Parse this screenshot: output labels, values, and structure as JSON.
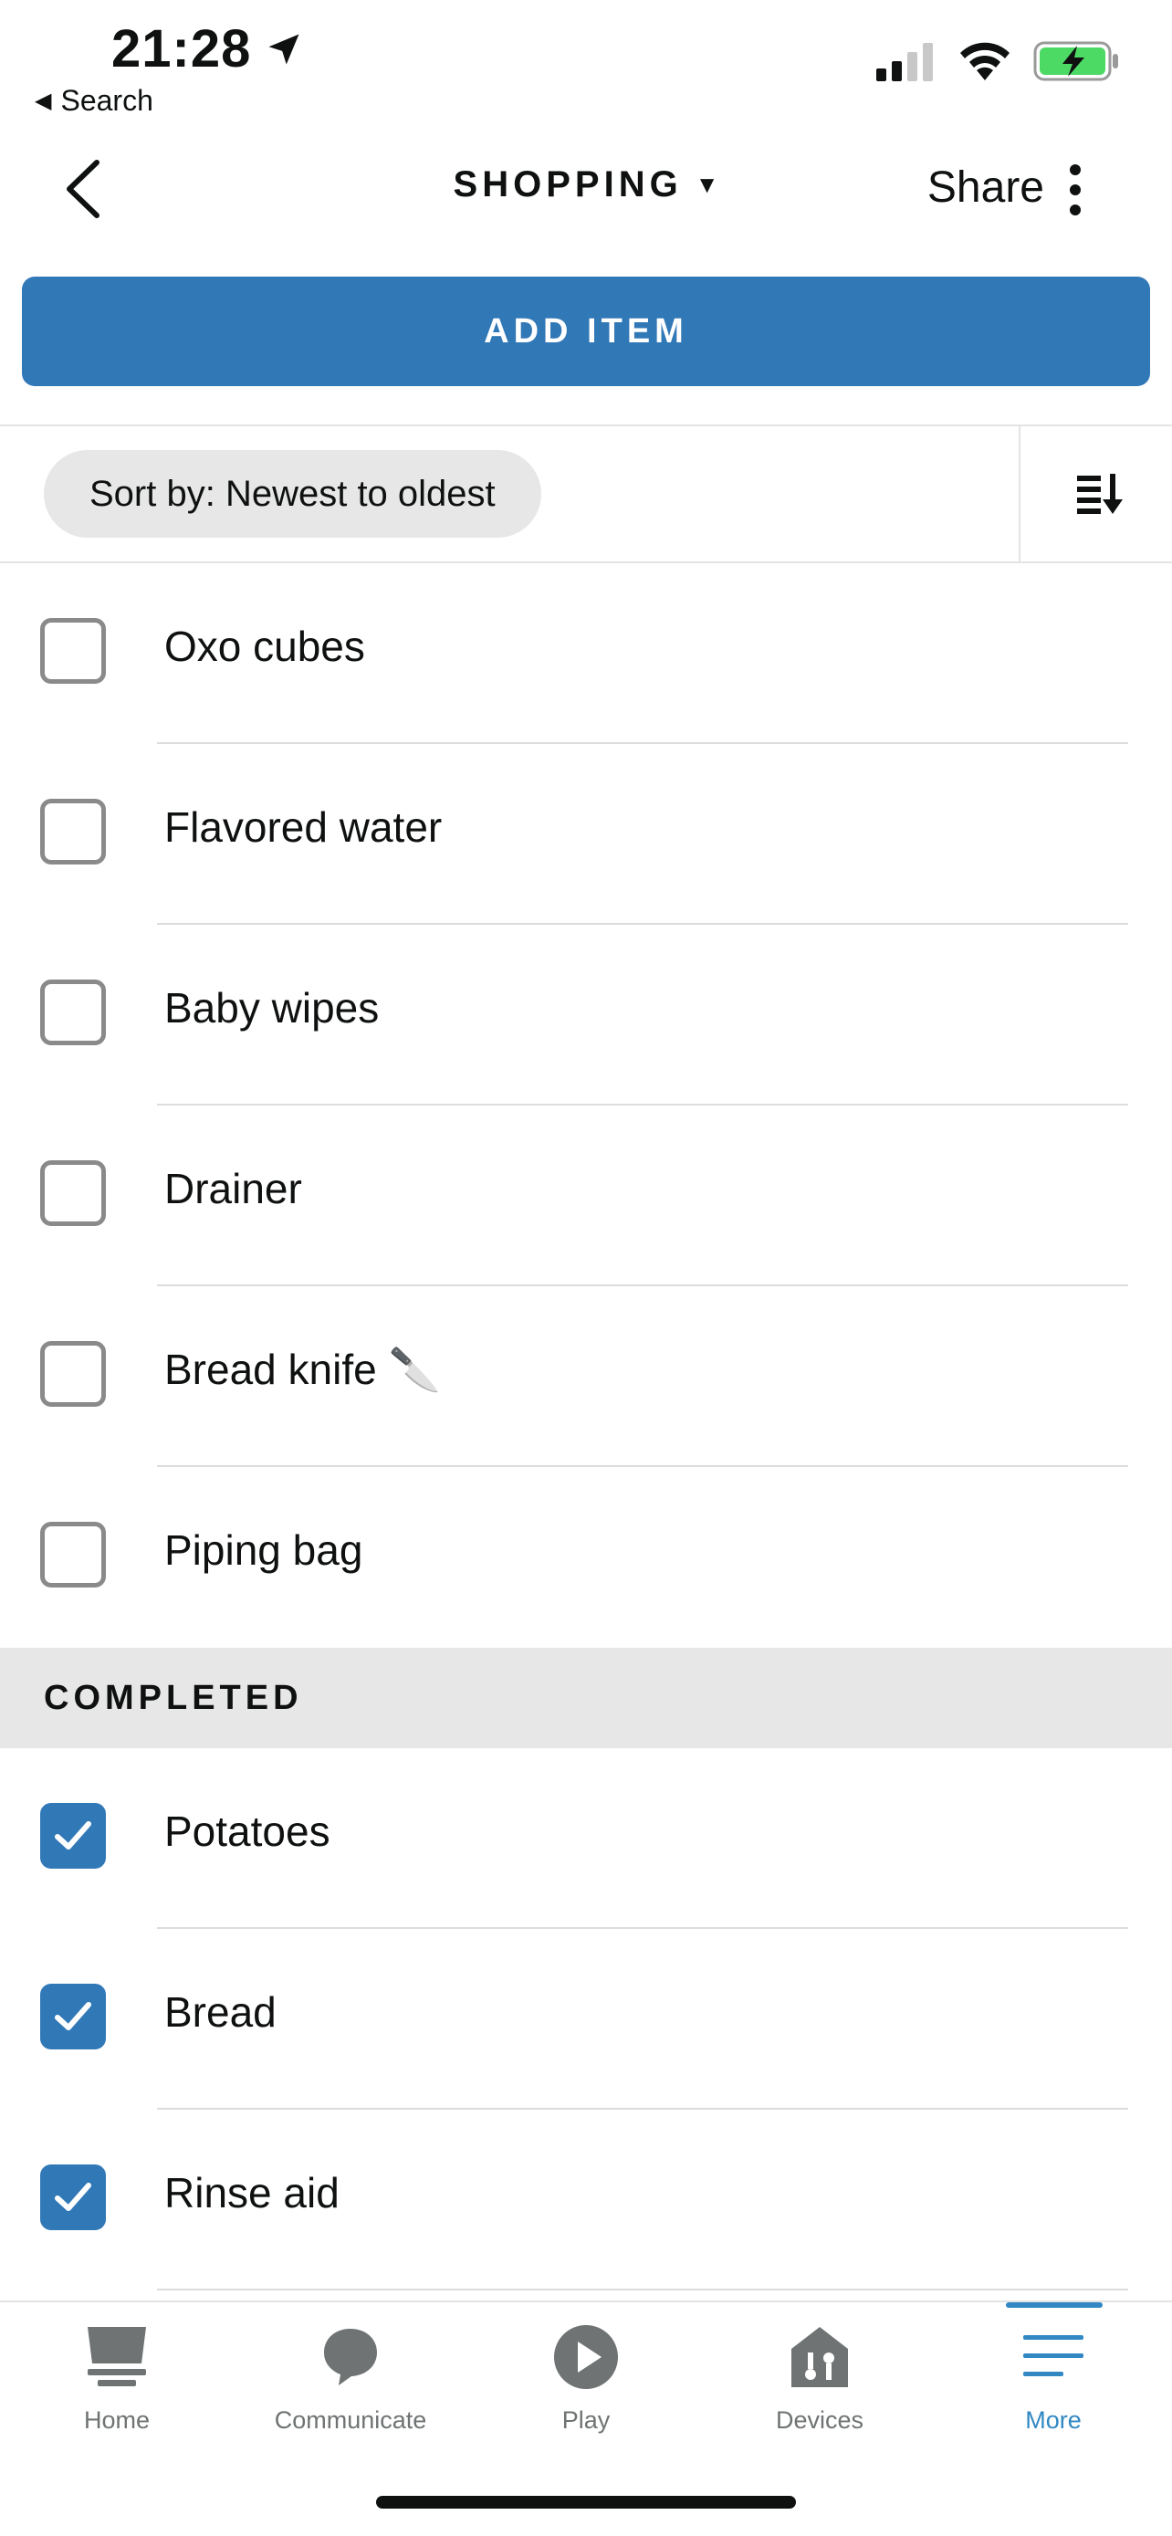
{
  "status_bar": {
    "time": "21:28",
    "back_app": "Search"
  },
  "header": {
    "title": "SHOPPING",
    "share_label": "Share"
  },
  "add_item_label": "ADD ITEM",
  "sort": {
    "label": "Sort by: Newest to oldest"
  },
  "items": [
    {
      "label": "Oxo cubes",
      "checked": false
    },
    {
      "label": "Flavored water",
      "checked": false
    },
    {
      "label": "Baby wipes",
      "checked": false
    },
    {
      "label": "Drainer",
      "checked": false
    },
    {
      "label": "Bread knife 🔪",
      "checked": false
    },
    {
      "label": "Piping bag",
      "checked": false
    }
  ],
  "completed": {
    "title": "COMPLETED",
    "items": [
      {
        "label": "Potatoes",
        "checked": true
      },
      {
        "label": "Bread",
        "checked": true
      },
      {
        "label": "Rinse aid",
        "checked": true
      }
    ]
  },
  "bottom_nav": [
    {
      "label": "Home",
      "icon": "home-icon",
      "active": false
    },
    {
      "label": "Communicate",
      "icon": "communicate-icon",
      "active": false
    },
    {
      "label": "Play",
      "icon": "play-icon",
      "active": false
    },
    {
      "label": "Devices",
      "icon": "devices-icon",
      "active": false
    },
    {
      "label": "More",
      "icon": "more-menu-icon",
      "active": true
    }
  ],
  "colors": {
    "accent": "#3178b7",
    "nav_active": "#3188c3",
    "battery": "#4cd964"
  }
}
